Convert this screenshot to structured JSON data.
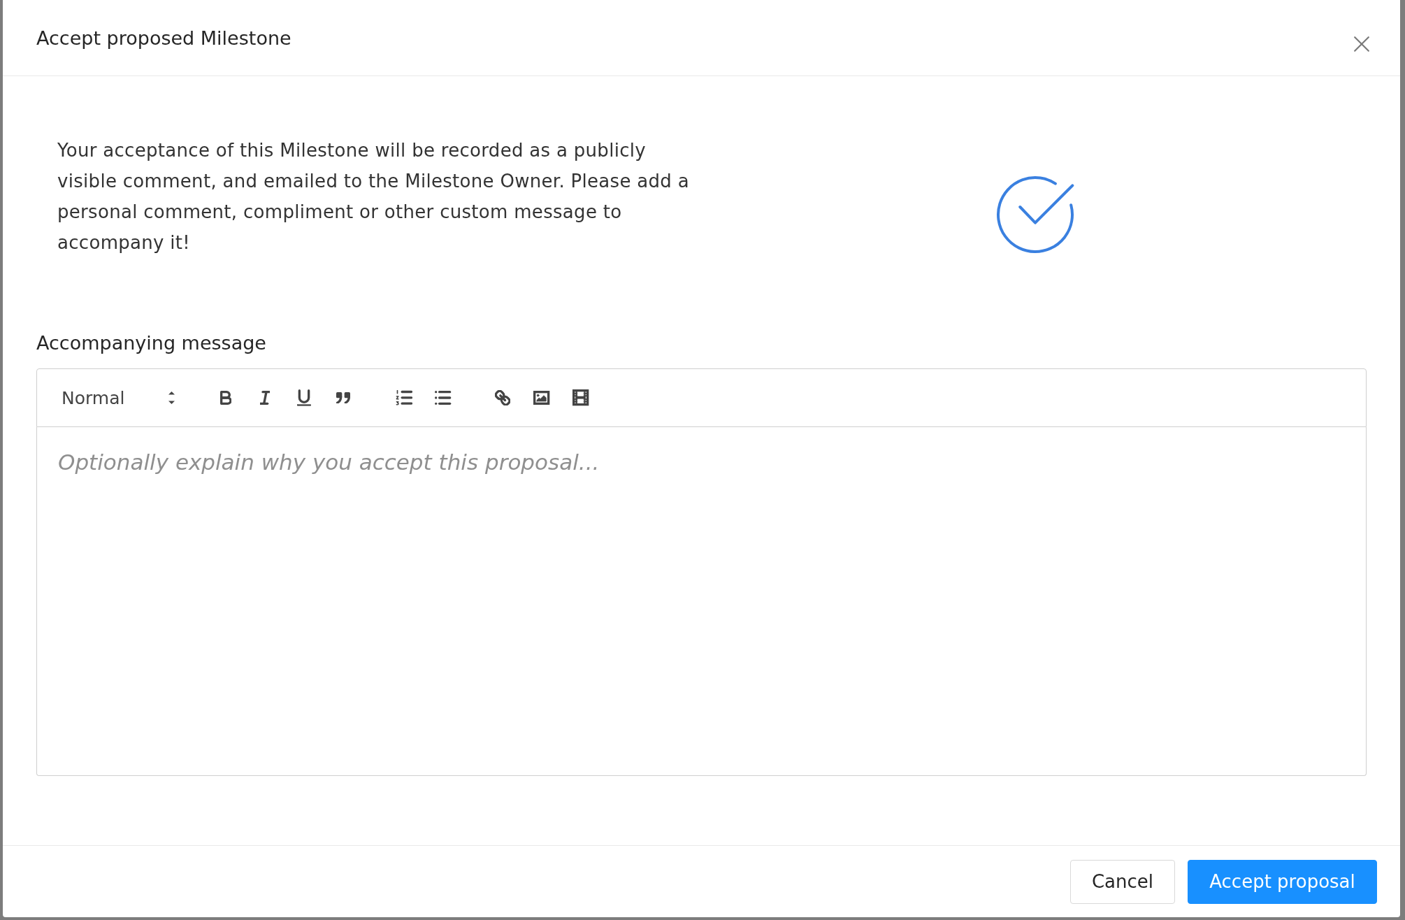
{
  "dialog": {
    "title": "Accept proposed Milestone"
  },
  "intro": {
    "text": "Your acceptance of this Milestone will be recorded as a publicly visible comment, and emailed to the Milestone Owner. Please add a personal comment, compliment or other custom message to accompany it!"
  },
  "message": {
    "label": "Accompanying message",
    "format": "Normal",
    "placeholder": "Optionally explain why you accept this proposal..."
  },
  "buttons": [
    {
      "label": "Cancel",
      "kind": "secondary"
    },
    {
      "label": "Accept proposal",
      "kind": "primary"
    }
  ]
}
